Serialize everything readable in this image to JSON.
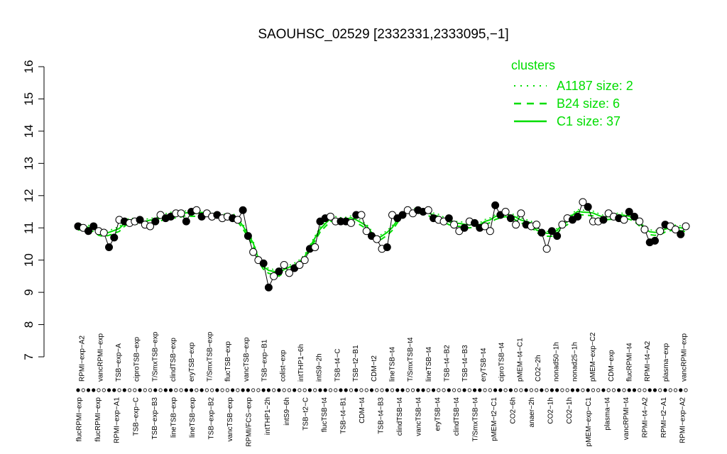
{
  "chart_data": {
    "type": "line",
    "title": "SAOUHSC_02529 [2332331,2333095,−1]",
    "xlabel": "",
    "ylabel": "",
    "ylim": [
      7,
      16
    ],
    "yticks": [
      7,
      8,
      9,
      10,
      11,
      12,
      13,
      14,
      15,
      16
    ],
    "grid": false,
    "legend": {
      "title": "clusters",
      "position": "top-right",
      "entries": [
        {
          "label": "A1187 size: 2",
          "style": "dotted"
        },
        {
          "label": "B24 size: 6",
          "style": "dashed"
        },
        {
          "label": "C1 size: 37",
          "style": "solid"
        }
      ]
    },
    "line_color": "#00dd00",
    "x_labels_top": [
      "RPMI−exp−A2",
      "vancRPMI−exp",
      "TSB−exp−A",
      "ciproTSB−exp",
      "T/SmxTSB−exp",
      "clindTSB−exp",
      "eryTSB−exp",
      "T/SmxTSB−exp",
      "flucTSB−exp",
      "vancTSB−exp",
      "TSB−exp−B1",
      "colist−exp",
      "intTHP1−6h",
      "intS9−2h",
      "TSB−t4−C",
      "TSB−t2−B1",
      "CDM−t2",
      "lineTSB−t4",
      "T/SmxTSB−t4",
      "lineTSB−t4",
      "TSB−t4−B2",
      "TSB−t4−B3",
      "eryTSB−t4",
      "ciproTSB−t4",
      "pMEM−t4−C1",
      "CO2−2h",
      "nonad50−1h",
      "nonad25−1h",
      "pMEM−exp−C2",
      "CDM−exp",
      "flucRPMI−t4",
      "RPMI−t4−A2",
      "plasma−exp",
      "vancRPMI−exp"
    ],
    "x_labels_bottom": [
      "flucRPMI−exp",
      "flucRPMI−exp",
      "RPMI−exp−A1",
      "TSB−exp−C",
      "TSB−exp−B3",
      "lineTSB−exp",
      "lineTSB−exp",
      "TSB−exp−B2",
      "vancTSB−exp",
      "RPMI/FCS−exp",
      "intTHP1−2h",
      "intS9−6h",
      "TSB−t2−C",
      "flucTSB−t4",
      "TSB−t4−B1",
      "CDM−t4",
      "TSB−t4−B3",
      "clindTSB−t4",
      "vancTSB−t4",
      "eryTSB−t4",
      "clindTSB−t4",
      "T/SmxTSB−t4",
      "pMEM−t2−C1",
      "CO2−6h",
      "anaer−2h",
      "CO2−1h",
      "CO2−1h",
      "pMEM−exp−C1",
      "plasma−t4",
      "vancRPMI−t4",
      "RPMI−t4−A2",
      "RPMI−t2−A1",
      "RPMI−exp−A2"
    ],
    "series": [
      {
        "values": [
          11.05,
          11.0,
          10.9,
          11.05,
          10.9,
          10.85,
          10.4,
          10.7,
          11.25,
          11.2,
          11.15,
          11.2,
          11.25,
          11.1,
          11.05,
          11.2,
          11.4,
          11.3,
          11.35,
          11.45,
          11.45,
          11.2,
          11.5,
          11.55,
          11.35,
          11.45,
          11.35,
          11.4,
          11.3,
          11.35,
          11.3,
          11.25,
          11.55,
          10.75,
          10.25,
          10.0,
          9.9,
          9.15,
          9.5,
          9.65,
          9.85,
          9.6,
          9.75,
          9.85,
          10.0,
          10.35,
          10.4,
          11.2,
          11.3,
          11.35,
          11.2,
          11.2,
          11.2,
          11.15,
          11.4,
          11.4,
          10.9,
          10.75,
          10.65,
          10.35,
          10.4,
          11.4,
          11.3,
          11.4,
          11.55,
          11.45,
          11.55,
          11.5,
          11.55,
          11.3,
          11.25,
          11.2,
          11.3,
          11.1,
          10.9,
          11.0,
          11.2,
          11.15,
          11.0,
          11.05,
          10.9,
          11.7,
          11.4,
          11.5,
          11.3,
          11.1,
          11.45,
          11.1,
          11.05,
          11.1,
          10.85,
          10.35,
          10.9,
          10.75,
          11.1,
          11.3,
          11.25,
          11.35,
          11.8,
          11.65,
          11.2,
          11.2,
          11.25,
          11.45,
          11.35,
          11.3,
          11.25,
          11.5,
          11.35,
          11.2,
          10.95,
          10.55,
          10.6,
          10.9,
          11.1,
          11.05,
          10.95,
          10.8,
          11.05
        ]
      }
    ]
  }
}
